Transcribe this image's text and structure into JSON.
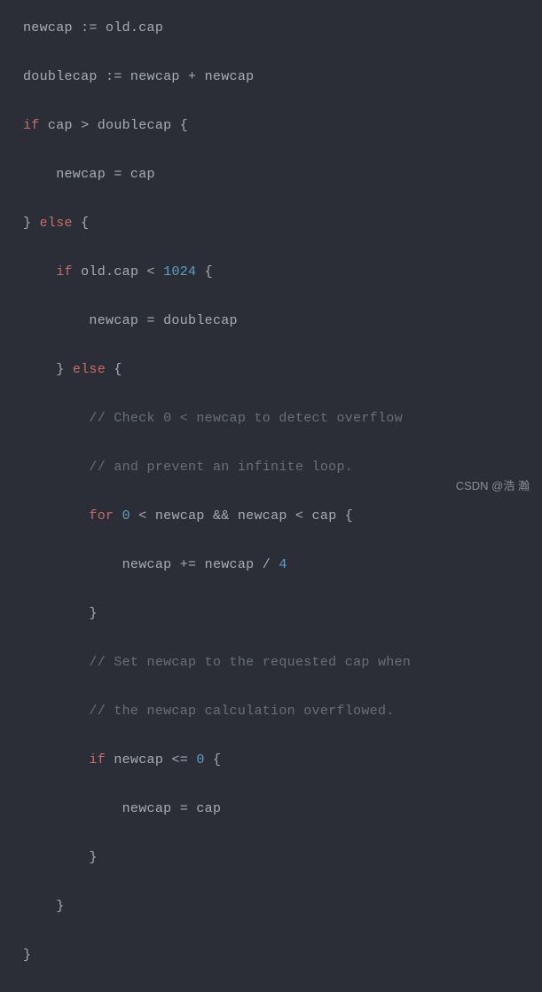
{
  "code": {
    "l1": {
      "t1": "newcap := old.cap"
    },
    "l2": {
      "t1": "doublecap := newcap + newcap"
    },
    "l3": {
      "kw": "if",
      "t1": " cap > doublecap {"
    },
    "l4": {
      "t1": "    newcap = cap"
    },
    "l5": {
      "t1": "} ",
      "kw": "else",
      "t2": " {"
    },
    "l6": {
      "pad": "    ",
      "kw": "if",
      "t1": " old.cap < ",
      "num": "1024",
      "t2": " {"
    },
    "l7": {
      "pad": "        ",
      "t1": "newcap = doublecap"
    },
    "l8": {
      "pad": "    ",
      "t1": "} ",
      "kw": "else",
      "t2": " {"
    },
    "l9": {
      "pad": "        ",
      "cm": "// Check 0 < newcap to detect overflow"
    },
    "l10": {
      "pad": "        ",
      "cm": "// and prevent an infinite loop."
    },
    "l11": {
      "pad": "        ",
      "kw": "for",
      "t1": " ",
      "num1": "0",
      "t2": " < newcap && newcap < cap {"
    },
    "l12": {
      "pad": "            ",
      "t1": "newcap += newcap / ",
      "num": "4"
    },
    "l13": {
      "pad": "        ",
      "t1": "}"
    },
    "l14": {
      "pad": "        ",
      "cm": "// Set newcap to the requested cap when"
    },
    "l15": {
      "pad": "        ",
      "cm": "// the newcap calculation overflowed."
    },
    "l16": {
      "pad": "        ",
      "kw": "if",
      "t1": " newcap <= ",
      "num": "0",
      "t2": " {"
    },
    "l17": {
      "pad": "            ",
      "t1": "newcap = cap"
    },
    "l18": {
      "pad": "        ",
      "t1": "}"
    },
    "l19": {
      "pad": "    ",
      "t1": "}"
    },
    "l20": {
      "t1": "}"
    }
  },
  "watermark": "CSDN @浩 瀚"
}
